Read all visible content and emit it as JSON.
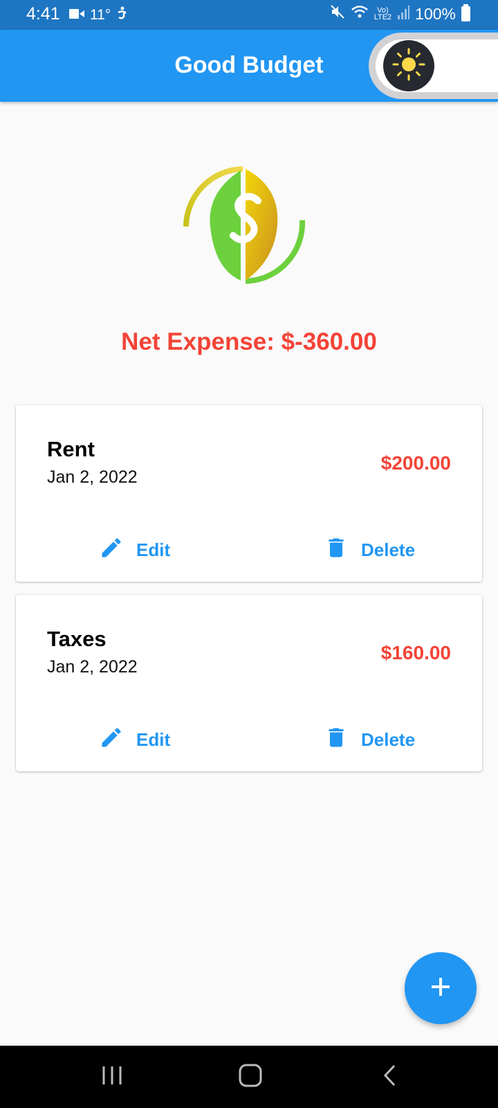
{
  "status_bar": {
    "time": "4:41",
    "temperature": "11°",
    "battery": "100%",
    "icons": [
      "video-icon",
      "accessibility-icon",
      "mute-icon",
      "wifi-icon",
      "volte-icon",
      "signal-icon",
      "battery-icon"
    ]
  },
  "app_bar": {
    "title": "Good Budget",
    "theme_toggle_icon": "sun-icon"
  },
  "summary": {
    "net_expense": "Net Expense: $-360.00"
  },
  "expenses": [
    {
      "title": "Rent",
      "date": "Jan 2, 2022",
      "amount": "$200.00",
      "edit_label": "Edit",
      "delete_label": "Delete"
    },
    {
      "title": "Taxes",
      "date": "Jan 2, 2022",
      "amount": "$160.00",
      "edit_label": "Edit",
      "delete_label": "Delete"
    }
  ],
  "fab": {
    "icon": "plus-icon"
  },
  "nav_bar": {
    "icons": [
      "recent-apps-icon",
      "home-icon",
      "back-icon"
    ]
  },
  "colors": {
    "primary": "#2196f3",
    "status_bar": "#1e75c2",
    "expense_red": "#f44336",
    "sun_yellow": "#fbd94a"
  }
}
